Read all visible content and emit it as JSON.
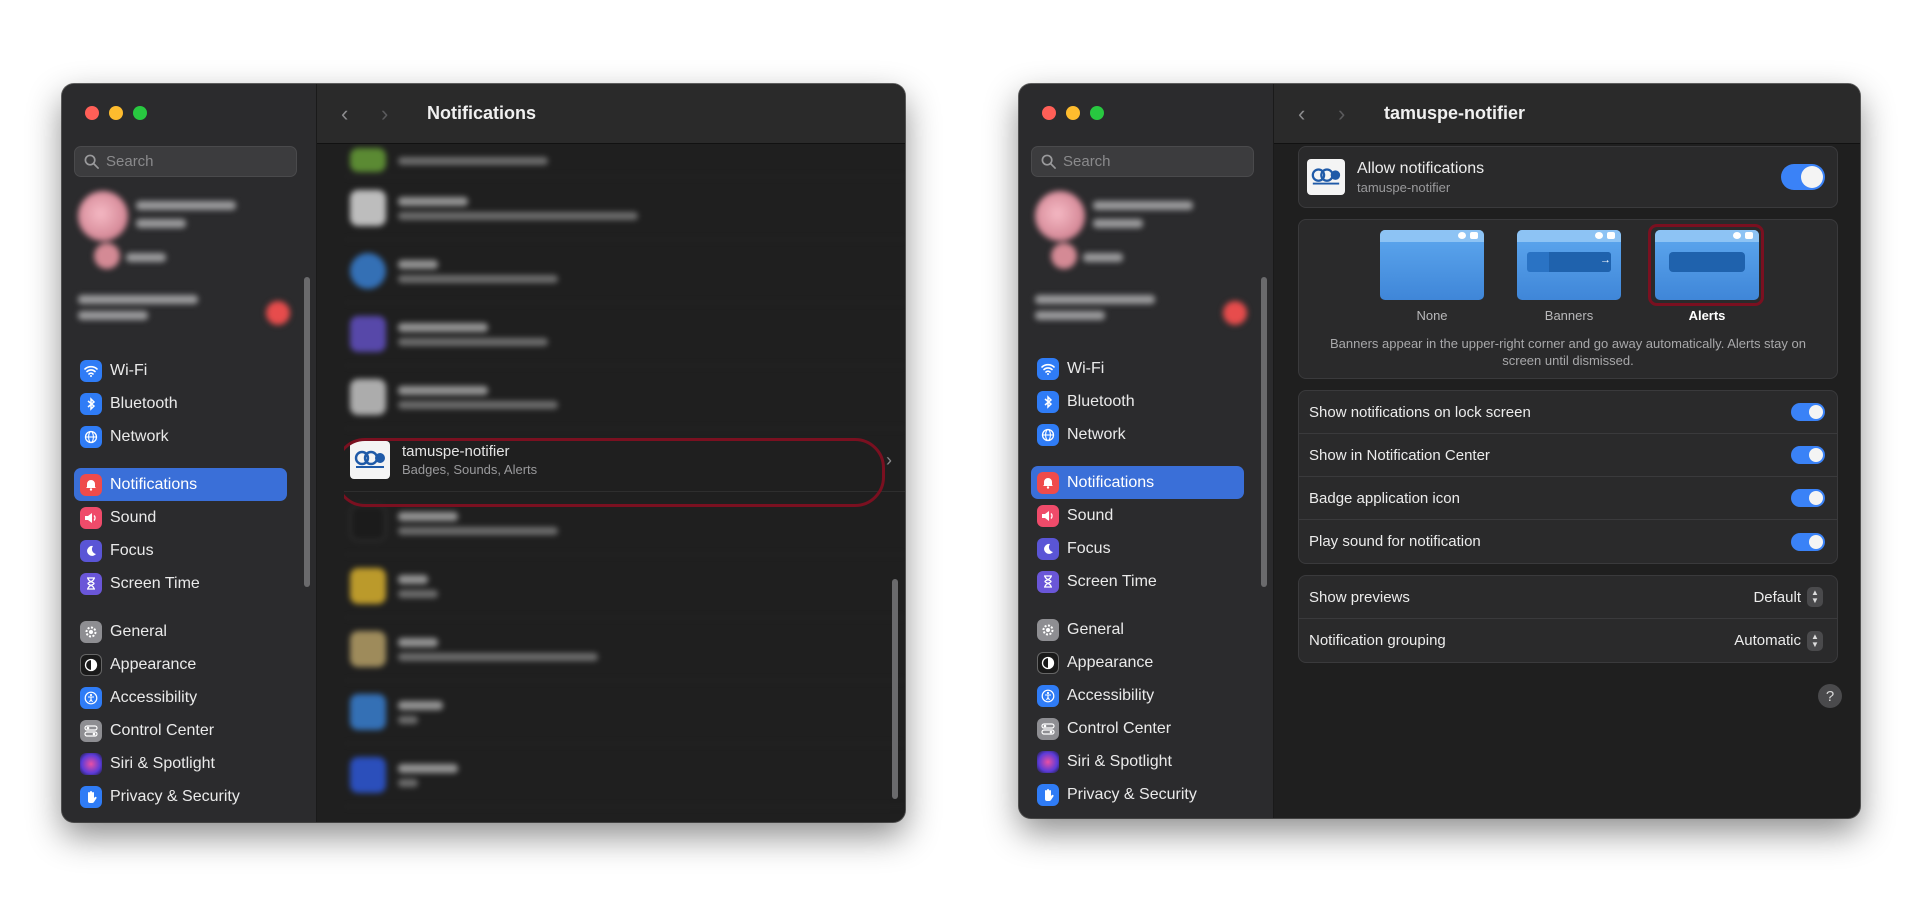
{
  "sidebar": {
    "search_placeholder": "Search",
    "items": [
      {
        "label": "Wi-Fi",
        "icon": "wifi-icon",
        "color": "#2f7cf6"
      },
      {
        "label": "Bluetooth",
        "icon": "bluetooth-icon",
        "color": "#2f7cf6"
      },
      {
        "label": "Network",
        "icon": "globe-icon",
        "color": "#2f7cf6"
      },
      {
        "label": "Notifications",
        "icon": "bell-icon",
        "color": "#ef4b4b"
      },
      {
        "label": "Sound",
        "icon": "speaker-icon",
        "color": "#ef4b6a"
      },
      {
        "label": "Focus",
        "icon": "moon-icon",
        "color": "#5a55d6"
      },
      {
        "label": "Screen Time",
        "icon": "hourglass-icon",
        "color": "#6a56d8"
      },
      {
        "label": "General",
        "icon": "gear-icon",
        "color": "#8e8e92"
      },
      {
        "label": "Appearance",
        "icon": "appearance-icon",
        "color": "#1a1a1a"
      },
      {
        "label": "Accessibility",
        "icon": "accessibility-icon",
        "color": "#2f7cf6"
      },
      {
        "label": "Control Center",
        "icon": "control-center-icon",
        "color": "#8e8e92"
      },
      {
        "label": "Siri & Spotlight",
        "icon": "siri-icon",
        "color": "#7a3cc8"
      },
      {
        "label": "Privacy & Security",
        "icon": "hand-icon",
        "color": "#2f7cf6"
      }
    ]
  },
  "left_window": {
    "title": "Notifications",
    "highlighted_app": {
      "name": "tamuspe-notifier",
      "detail": "Badges, Sounds, Alerts"
    }
  },
  "right_window": {
    "title": "tamuspe-notifier",
    "allow": {
      "label": "Allow notifications",
      "sub": "tamuspe-notifier",
      "on": true
    },
    "alert_styles": {
      "none": "None",
      "banners": "Banners",
      "alerts": "Alerts",
      "selected": "Alerts"
    },
    "style_description": "Banners appear in the upper-right corner and go away automatically. Alerts stay on screen until dismissed.",
    "toggles": [
      {
        "label": "Show notifications on lock screen",
        "on": true
      },
      {
        "label": "Show in Notification Center",
        "on": true
      },
      {
        "label": "Badge application icon",
        "on": true
      },
      {
        "label": "Play sound for notification",
        "on": true
      }
    ],
    "selects": [
      {
        "label": "Show previews",
        "value": "Default"
      },
      {
        "label": "Notification grouping",
        "value": "Automatic"
      }
    ],
    "help_label": "?"
  }
}
